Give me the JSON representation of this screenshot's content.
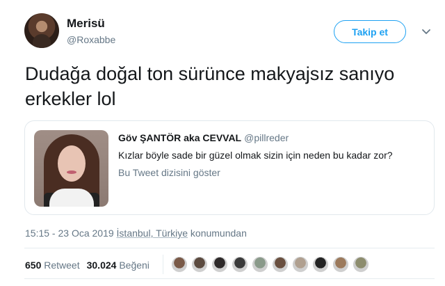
{
  "author": {
    "name": "Merisü",
    "handle": "@Roxabbe",
    "follow_label": "Takip et"
  },
  "tweet": {
    "text": "Dudağa doğal ton sürünce makyajsız sanıyo erkekler lol"
  },
  "quoted": {
    "name": "Göv ŞANTÖR aka CEVVAL",
    "handle": "@pillreder",
    "text": "Kızlar böyle sade bir güzel olmak sizin için neden bu kadar zor?",
    "thread_link": "Bu Tweet dizisini göster"
  },
  "meta": {
    "time": "15:15 - 23 Oca 2019",
    "location": "İstanbul, Türkiye",
    "suffix": "konumundan"
  },
  "stats": {
    "retweets": "650",
    "retweets_label": "Retweet",
    "likes": "30.024",
    "likes_label": "Beğeni"
  },
  "colors": {
    "accent": "#1da1f2",
    "secondary_text": "#657786",
    "border": "#e1e8ed",
    "likers": [
      "#7a5a48",
      "#5b4a3f",
      "#2e2a2a",
      "#3b3b3b",
      "#8a9a8a",
      "#6a5040",
      "#b0a090",
      "#242424",
      "#9c7a5c",
      "#8d8d6e"
    ]
  },
  "icons": {
    "caret": "chevron-down-icon"
  }
}
